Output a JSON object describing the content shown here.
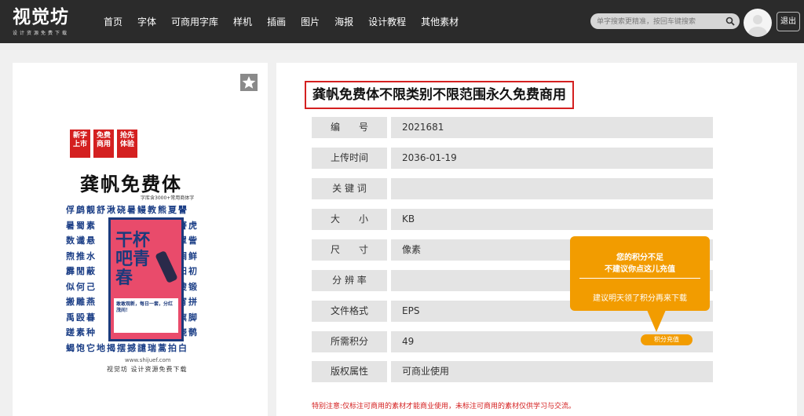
{
  "header": {
    "logo_text": "视觉坊",
    "logo_subtitle": "设计资源免费下载",
    "nav": [
      "首页",
      "字体",
      "可商用字库",
      "样机",
      "插画",
      "图片",
      "海报",
      "设计教程",
      "其他素材"
    ],
    "search_placeholder": "单字搜索更精准，按回车键搜索",
    "logout_label": "退出"
  },
  "poster": {
    "badges": [
      "新字\n上市",
      "免费\n商用",
      "抢先\n体验"
    ],
    "title": "龚帆免费体",
    "subtitle": "字库含3000+常用商体字",
    "glyph_rows": [
      "俘鹧靓舒湫硗暑鳗教熊夏譻",
      "暑蜀素　　　　　　　暨謇虎",
      "数谶悬　　　　　　　撞罩訾",
      "煦推水　　　　　　　碳裥鲜",
      "霹閒蔽　　　　　　　开阳初",
      "似何己　　　　　　　浦搜锻",
      "搬雕燕　　　　　　　媚宵拼",
      "禹殴暮　　　　　　　韵旗脚",
      "蹉素种　　　　　　　豪烧鹡",
      "蝎饱它地揭摆撼譴瑞蒿拍白"
    ],
    "inner_big": "干杯吧青春",
    "inner_banner": "敢敢观新，每日一套，分红茂间！",
    "url": "www.shijuef.com",
    "footer": "视觉坊 设计资源免费下载"
  },
  "detail": {
    "title": "龚帆免费体不限类别不限范围永久免费商用",
    "rows": [
      {
        "label": "编　　号",
        "value": "2021681"
      },
      {
        "label": "上传时间",
        "value": "2036-01-19"
      },
      {
        "label": "关 键 词",
        "value": ""
      },
      {
        "label": "大　　小",
        "value": "KB"
      },
      {
        "label": "尺　　寸",
        "value": "像素"
      },
      {
        "label": "分 辨 率",
        "value": ""
      },
      {
        "label": "文件格式",
        "value": "EPS"
      },
      {
        "label": "所需积分",
        "value": "49"
      },
      {
        "label": "版权属性",
        "value": "可商业使用"
      }
    ],
    "note": "特别注意:仅标注可商用的素材才能商业使用，未标注可商用的素材仅供学习与交流。"
  },
  "tooltip": {
    "line1": "您的积分不足",
    "line2": "不建议你点这儿充值",
    "line3": "建议明天领了积分再来下载",
    "button": "积分充值"
  },
  "colors": {
    "header_bg": "#2b2b2b",
    "accent_red": "#d42020",
    "tooltip_orange": "#f29c00",
    "row_bg": "#e4e4e4"
  },
  "icons": [
    "search-icon",
    "star-icon",
    "avatar-icon"
  ]
}
